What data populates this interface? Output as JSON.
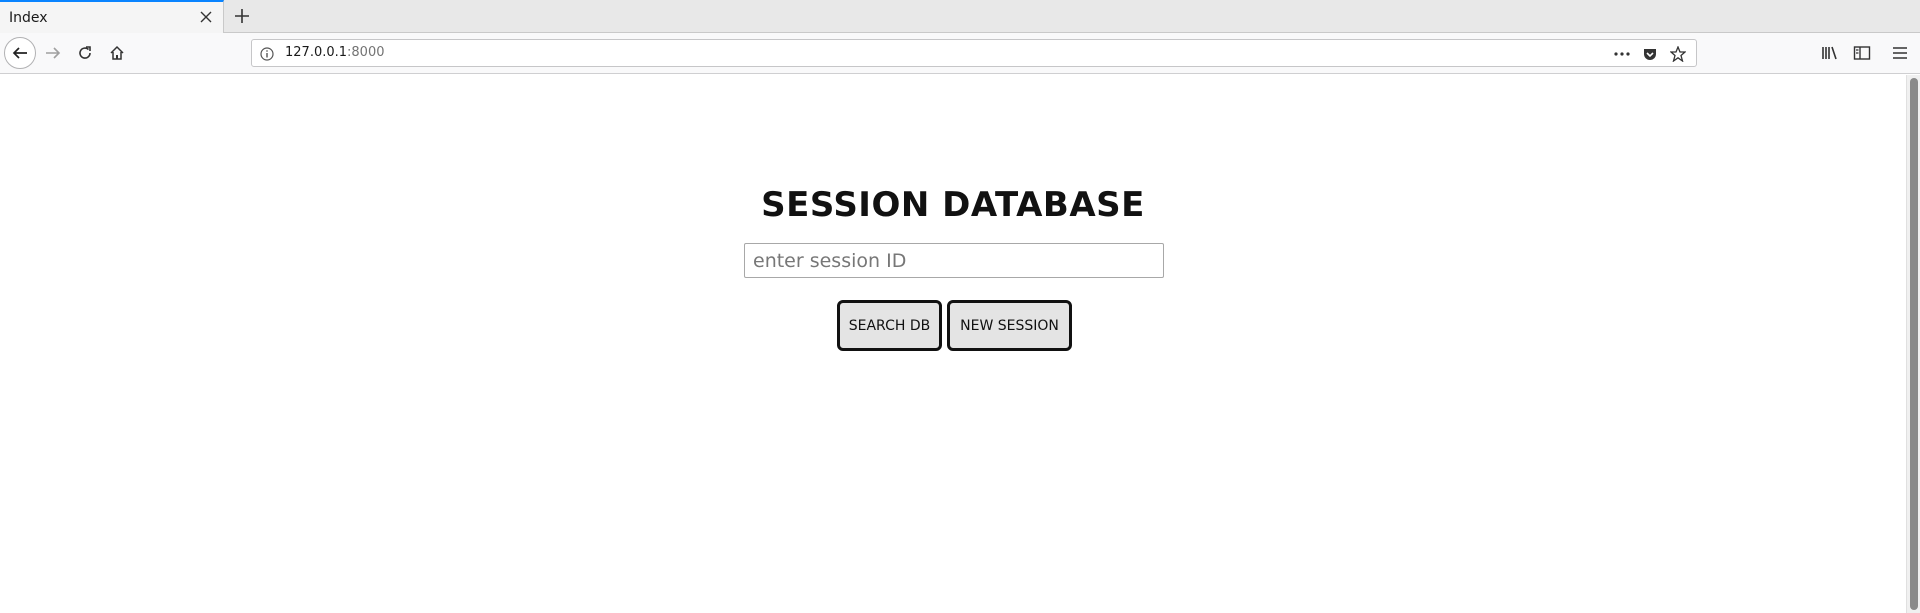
{
  "browser": {
    "tab": {
      "title": "Index"
    },
    "url": {
      "host": "127.0.0.1",
      "port": ":8000"
    },
    "icons": {
      "tab_close": "close-icon",
      "new_tab": "plus-icon",
      "back": "back-arrow-icon",
      "forward": "forward-arrow-icon",
      "reload": "reload-icon",
      "home": "home-icon",
      "site_info": "info-icon",
      "page_actions": "ellipsis-icon",
      "pocket": "pocket-icon",
      "bookmark": "star-icon",
      "library": "library-icon",
      "sidebar": "sidebar-icon",
      "menu": "hamburger-menu-icon"
    }
  },
  "page": {
    "title": "SESSION DATABASE",
    "search_input": {
      "placeholder": "enter session ID",
      "value": ""
    },
    "buttons": {
      "search_label": "SEARCH DB",
      "new_label": "NEW SESSION"
    }
  },
  "colors": {
    "tab_accent": "#0a84ff",
    "button_bg": "#e4e4e4",
    "button_border": "#111111"
  }
}
